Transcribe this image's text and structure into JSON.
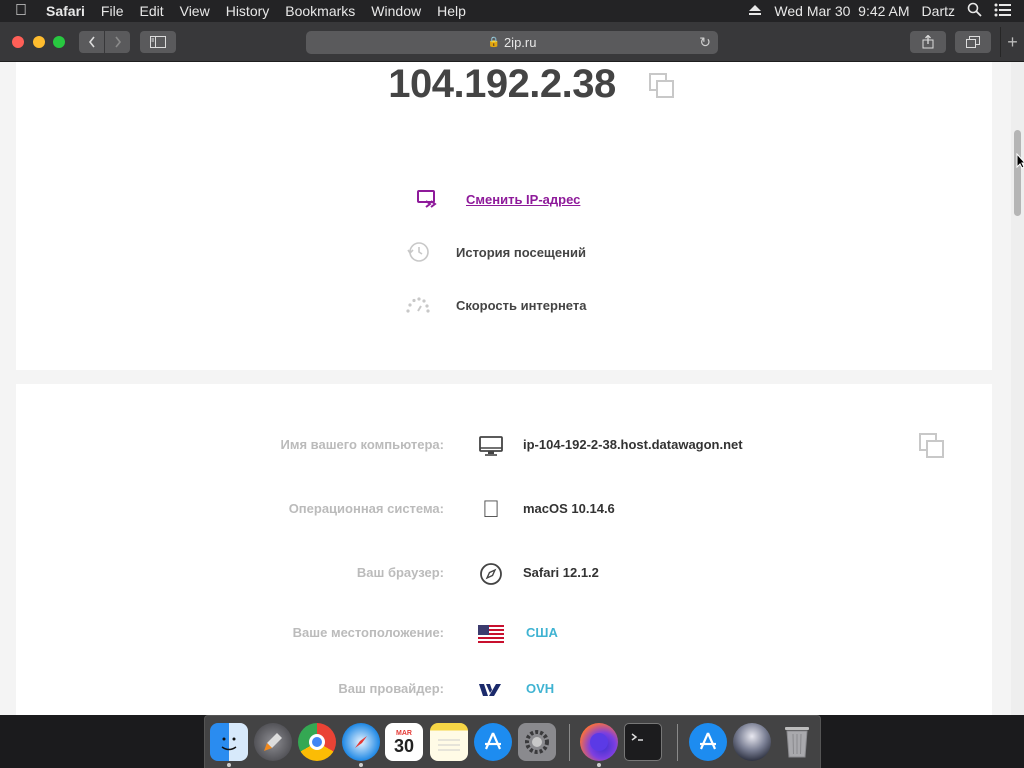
{
  "menubar": {
    "app_name": "Safari",
    "menus": [
      "File",
      "Edit",
      "View",
      "History",
      "Bookmarks",
      "Window",
      "Help"
    ],
    "datetime": "Wed Mar 30  9:42 AM",
    "user": "Dartz",
    "status_icons": [
      "eject-icon",
      "spotlight-search-icon",
      "notification-center-icon"
    ]
  },
  "browser": {
    "url": "2ip.ru",
    "buttons": [
      "back",
      "forward",
      "sidebar",
      "reload",
      "share",
      "show-all-tabs",
      "new-tab"
    ]
  },
  "page": {
    "ip": "104.192.2.38",
    "actions": [
      {
        "label": "Сменить IP-адрес",
        "icon": "change-ip-icon",
        "link": true
      },
      {
        "label": "История посещений",
        "icon": "history-icon",
        "link": false
      },
      {
        "label": "Скорость интернета",
        "icon": "speedometer-icon",
        "link": false
      }
    ],
    "info": [
      {
        "label": "Имя вашего компьютера:",
        "value": "ip-104-192-2-38.host.datawagon.net",
        "icon": "computer-icon"
      },
      {
        "label": "Операционная система:",
        "value": "macOS 10.14.6",
        "icon": "apple-icon"
      },
      {
        "label": "Ваш браузер:",
        "value": "Safari 12.1.2",
        "icon": "safari-compass-icon"
      },
      {
        "label": "Ваше местоположение:",
        "value": "США",
        "icon": "us-flag-icon"
      },
      {
        "label": "Ваш провайдер:",
        "value": "OVH",
        "icon": "ovh-logo-icon"
      }
    ]
  },
  "dock": {
    "apps": [
      "Finder",
      "Launchpad",
      "Google Chrome",
      "Safari",
      "Calendar",
      "Notes",
      "App Store",
      "System Preferences",
      "Firefox",
      "Terminal",
      "App Store",
      "Photo",
      "Trash"
    ],
    "calendar": {
      "month": "MAR",
      "day": "30"
    }
  },
  "colors": {
    "link": "#8e1a9a",
    "accent": "#3fb3d2",
    "ip_text": "#444444",
    "label_gray": "#bbbbbb"
  }
}
